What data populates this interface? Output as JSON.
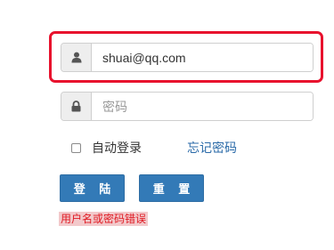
{
  "login_form": {
    "username": {
      "value": "shuai@qq.com",
      "icon": "user-icon"
    },
    "password": {
      "placeholder": "密码",
      "value": "",
      "icon": "lock-icon"
    },
    "remember_label": "自动登录",
    "remember_checked": false,
    "forgot_link": "忘记密码",
    "login_button": "登 陆",
    "reset_button": "重 置",
    "error_message": "用户名或密码错误"
  },
  "colors": {
    "highlight_border": "#e8112d",
    "button_primary": "#337ab7",
    "link": "#2a6aa8",
    "error_text": "#e01b24",
    "error_bg": "#f2c9cb"
  }
}
